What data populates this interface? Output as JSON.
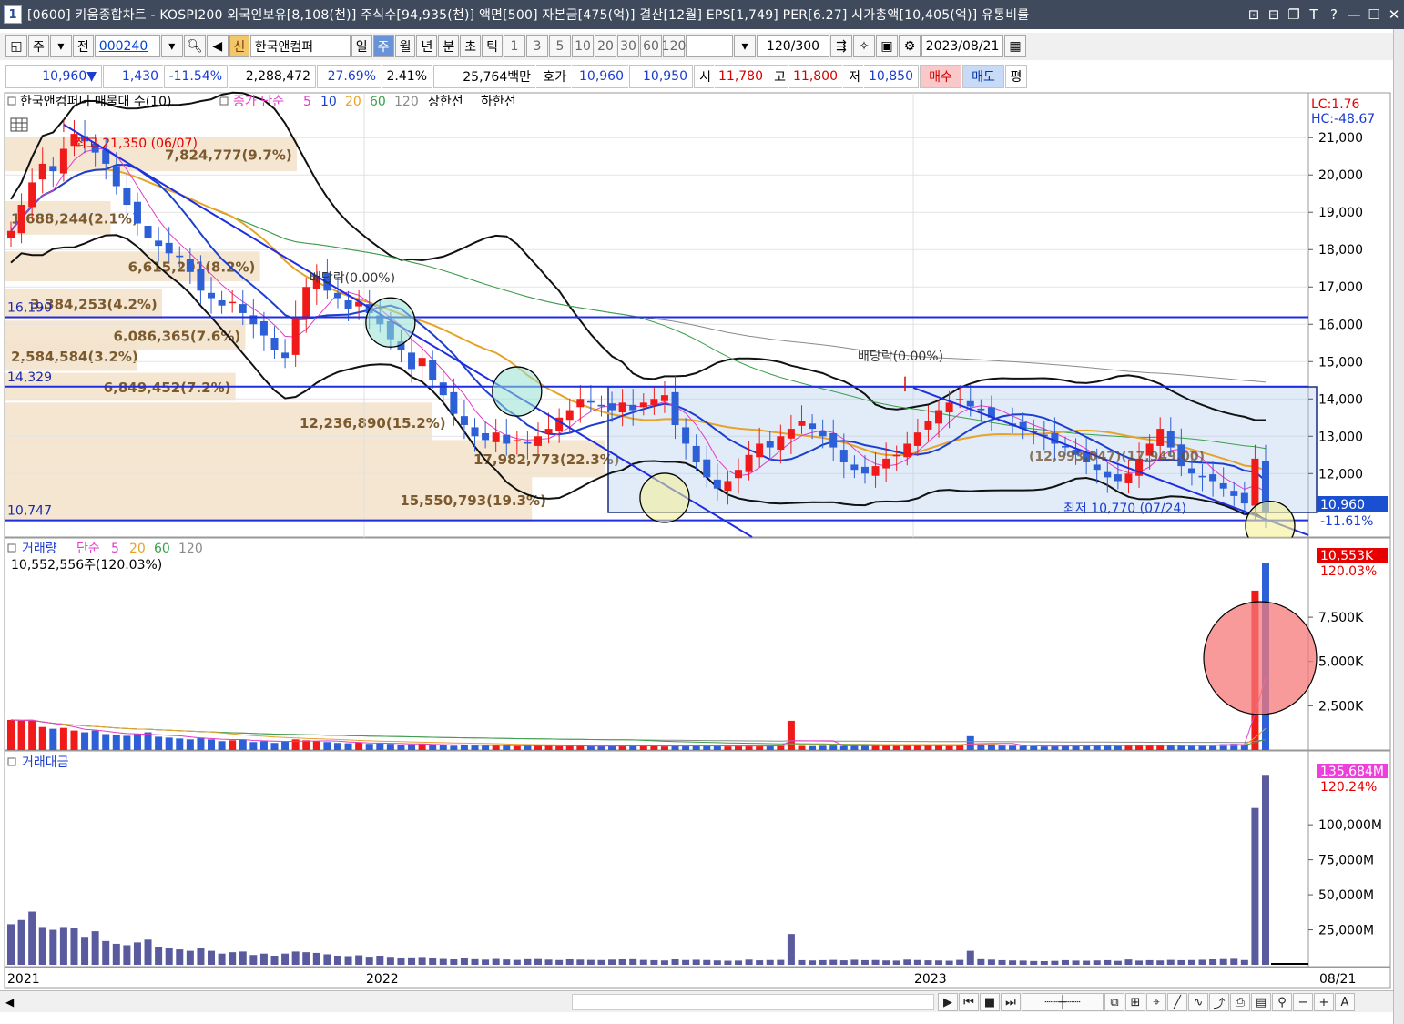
{
  "window": {
    "index": "1",
    "title": "[0600] 키움종합차트 - KOSPI200 외국인보유[8,108(천)] 주식수[94,935(천)] 액면[500] 자본금[475(억)] 결산[12월] EPS[1,749] PER[6.27] 시가총액[10,405(억)] 유통비률",
    "controls": [
      "⊡",
      "⊟",
      "❐",
      "T",
      "?",
      "—",
      "☐",
      "✕"
    ]
  },
  "toolbar": {
    "period_primary": "주",
    "full_label": "전",
    "stock_code": "000240",
    "new_badge": "신",
    "stock_name": "한국앤컴퍼",
    "periods": [
      "일",
      "주",
      "월",
      "년",
      "분",
      "초",
      "틱"
    ],
    "selected_period": "주",
    "intervals": [
      "1",
      "3",
      "5",
      "10",
      "20",
      "30",
      "60",
      "120"
    ],
    "count_display": "120/300",
    "date": "2023/08/21"
  },
  "quote": {
    "price": "10,960▼",
    "change": "1,430",
    "change_pct": "-11.54%",
    "volume": "2,288,472",
    "vol_ratio": "27.69%",
    "turnover": "2.41%",
    "amount": "25,764백만",
    "hoga_label": "호가",
    "ask": "10,960",
    "bid": "10,950",
    "open_label": "시",
    "open": "11,780",
    "high_label": "고",
    "high": "11,800",
    "low_label": "저",
    "low": "10,850",
    "buy_label": "매수",
    "sell_label": "매도",
    "avg_label": "평"
  },
  "chart_data": [
    {
      "type": "candlestick",
      "title": "한국앤컴퍼니 매물대 수(10)",
      "legend": {
        "prefix": "종가 단순",
        "ma": [
          "5",
          "10",
          "20",
          "60",
          "120"
        ],
        "extra": [
          "상한선",
          "하한선"
        ]
      },
      "colors": {
        "up": "#f01a1a",
        "down": "#2d5fd6",
        "ma5": "#e23cc8",
        "ma10": "#1d3fcf",
        "ma20": "#e6a32a",
        "ma60": "#3aa04a",
        "ma120": "#8a8a8a",
        "bands": "#111111",
        "trend": "#1e2ee0"
      },
      "x_labels": [
        "2021",
        "2022",
        "2023",
        "08/21"
      ],
      "y_ticks": [
        12000,
        13000,
        14000,
        15000,
        16000,
        17000,
        18000,
        19000,
        20000,
        21000
      ],
      "y_tick_labels": [
        "12,000",
        "13,000",
        "14,000",
        "15,000",
        "16,000",
        "17,000",
        "18,000",
        "19,000",
        "20,000",
        "21,000"
      ],
      "ylim": [
        10300,
        22200
      ],
      "top_right_labels": [
        "LC:1.76",
        "HC:-48.67"
      ],
      "price_tag": "10,960",
      "price_tag_pct": "-11.61%",
      "left_levels": [
        {
          "label": "16,190",
          "value": 16190
        },
        {
          "label": "14,329",
          "value": 14329
        },
        {
          "label": "10,747",
          "value": 10747
        }
      ],
      "annotations": {
        "high": "최고 21,350 (06/07)",
        "low": "최저 10,770 (07/24)",
        "ex_dividend_1": "배당락(0.00%)",
        "ex_dividend_2": "배당락(0.00%)"
      },
      "volume_profile": [
        {
          "price_high": 21000,
          "price_low": 20100,
          "label": "7,824,777(9.7%)"
        },
        {
          "price_high": 19300,
          "price_low": 18400,
          "label": "1,688,244(2.1%)"
        },
        {
          "price_high": 17950,
          "price_low": 17150,
          "label": "6,615,291(8.2%)"
        },
        {
          "price_high": 16950,
          "price_low": 16150,
          "label": "3,384,253(4.2%)"
        },
        {
          "price_high": 16100,
          "price_low": 15300,
          "label": "6,086,365(7.6%)"
        },
        {
          "price_high": 15550,
          "price_low": 14750,
          "label": "2,584,584(3.2%)"
        },
        {
          "price_high": 14700,
          "price_low": 13950,
          "label": "6,849,452(7.2%)"
        },
        {
          "price_high": 13900,
          "price_low": 12850,
          "label": "12,236,890(15.2%)"
        },
        {
          "price_high": 12900,
          "price_low": 11900,
          "label": "17,982,773(22.3%)"
        },
        {
          "price_high": 11900,
          "price_low": 10700,
          "label": "15,550,793(19.3%)"
        }
      ],
      "volume_profile_overlay_text": "(12,993,047)(17,949.00)",
      "weeks": 120,
      "close": [
        18500,
        19200,
        19800,
        20300,
        20100,
        20700,
        21100,
        20900,
        20600,
        20300,
        19700,
        19200,
        18700,
        18300,
        18100,
        17900,
        17800,
        17400,
        16900,
        16700,
        16500,
        16600,
        16300,
        16000,
        15700,
        15300,
        15100,
        16200,
        17000,
        17300,
        16900,
        16700,
        16400,
        16600,
        16300,
        16000,
        15600,
        15300,
        14800,
        15100,
        14500,
        14100,
        13600,
        13300,
        13000,
        12900,
        13100,
        12800,
        12900,
        12800,
        13000,
        13200,
        13500,
        13700,
        14000,
        13900,
        13800,
        13700,
        13900,
        13700,
        13900,
        14000,
        14100,
        13300,
        12800,
        12300,
        11900,
        11600,
        11800,
        12100,
        12500,
        12800,
        12700,
        13000,
        13200,
        13400,
        13200,
        13000,
        12700,
        12300,
        12100,
        12000,
        12200,
        12400,
        12500,
        12800,
        13100,
        13400,
        13700,
        13900,
        14000,
        13800,
        13700,
        13500,
        13400,
        13300,
        13200,
        13100,
        13000,
        12800,
        12700,
        12500,
        12300,
        12100,
        11900,
        11800,
        12000,
        12400,
        12800,
        13200,
        12700,
        12200,
        12000,
        11900,
        11800,
        11600,
        11400,
        11200,
        12400,
        10960
      ],
      "volume_panel": {
        "title": "거래량",
        "legend": {
          "prefix": "단순",
          "ma": [
            "5",
            "20",
            "60",
            "120"
          ]
        },
        "current_text": "10,552,556주(120.03%)",
        "tag": "10,553K",
        "tag_pct": "120.03%",
        "y_tick_labels": [
          "2,500K",
          "5,000K",
          "7,500K"
        ],
        "y_ticks": [
          2500,
          5000,
          7500
        ],
        "ylim": [
          0,
          11000
        ],
        "values_k": [
          1700,
          1650,
          1700,
          1300,
          1200,
          1250,
          1100,
          1000,
          1100,
          900,
          850,
          800,
          900,
          1000,
          750,
          700,
          650,
          600,
          700,
          600,
          500,
          550,
          600,
          450,
          500,
          400,
          500,
          600,
          550,
          500,
          450,
          400,
          380,
          420,
          350,
          400,
          350,
          300,
          320,
          350,
          280,
          260,
          240,
          300,
          250,
          230,
          260,
          240,
          220,
          250,
          260,
          230,
          210,
          240,
          230,
          220,
          210,
          230,
          240,
          250,
          220,
          210,
          200,
          260,
          230,
          250,
          240,
          220,
          200,
          210,
          260,
          230,
          240,
          250,
          1650,
          230,
          220,
          240,
          250,
          230,
          260,
          240,
          250,
          230,
          220,
          270,
          250,
          240,
          230,
          220,
          260,
          780,
          300,
          280,
          250,
          240,
          230,
          210,
          200,
          220,
          260,
          240,
          230,
          250,
          260,
          220,
          300,
          240,
          260,
          250,
          280,
          260,
          270,
          290,
          310,
          330,
          350,
          280,
          9000,
          10552
        ]
      },
      "amount_panel": {
        "title": "거래대금",
        "tag": "135,684M",
        "tag_pct": "120.24%",
        "y_tick_labels": [
          "25,000M",
          "50,000M",
          "75,000M",
          "100,000M"
        ],
        "y_ticks": [
          25000,
          50000,
          75000,
          100000
        ],
        "ylim": [
          0,
          143000
        ],
        "values_m": [
          29000,
          32000,
          38000,
          27000,
          25000,
          27000,
          26000,
          20000,
          24000,
          17000,
          15000,
          14000,
          16000,
          18000,
          13000,
          12000,
          11000,
          10000,
          12000,
          10000,
          8000,
          9000,
          9500,
          7000,
          8000,
          6500,
          8000,
          9500,
          9000,
          8500,
          7500,
          6500,
          6200,
          6800,
          5800,
          6500,
          5700,
          5000,
          5300,
          5600,
          4600,
          4200,
          3900,
          4800,
          4000,
          3700,
          4200,
          3800,
          3500,
          4000,
          4100,
          3700,
          3400,
          3900,
          3700,
          3500,
          3400,
          3700,
          3900,
          4000,
          3500,
          3300,
          3100,
          3900,
          3400,
          3600,
          3400,
          3100,
          2900,
          3000,
          3700,
          3200,
          3400,
          3500,
          22000,
          3300,
          3100,
          3300,
          3500,
          3200,
          3600,
          3300,
          3400,
          3100,
          3000,
          3700,
          3400,
          3200,
          3100,
          2900,
          3500,
          10000,
          4000,
          3700,
          3300,
          3100,
          3000,
          2700,
          2600,
          2800,
          3300,
          3000,
          2900,
          3100,
          3300,
          2800,
          3800,
          3000,
          3300,
          3100,
          3500,
          3300,
          3400,
          3600,
          3900,
          4100,
          4300,
          3400,
          112000,
          135684
        ]
      }
    }
  ]
}
